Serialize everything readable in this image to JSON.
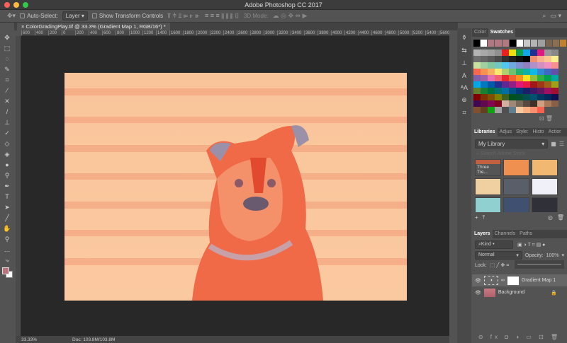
{
  "window": {
    "title": "Adobe Photoshop CC 2017",
    "traffic": [
      "#fc605c",
      "#fdbc40",
      "#34c84a"
    ]
  },
  "options": {
    "auto_select_label": "Auto-Select:",
    "auto_select_value": "Layer",
    "transform_label": "Show Transform Controls",
    "mode_3d_label": "3D Mode:"
  },
  "document": {
    "tab_title": "ColorGradingPlay.tif @ 33.3% (Gradient Map 1, RGB/16*) *",
    "ruler_ticks": [
      "600",
      "400",
      "200",
      "0",
      "200",
      "400",
      "600",
      "800",
      "1000",
      "1200",
      "1400",
      "1600",
      "1800",
      "2000",
      "2200",
      "2400",
      "2600",
      "2800",
      "3000",
      "3200",
      "3400",
      "3600",
      "3800",
      "4000",
      "4200",
      "4400",
      "4600",
      "4800",
      "5000",
      "5200",
      "5400",
      "5600",
      "5"
    ]
  },
  "status": {
    "zoom": "33.33%",
    "doc": "Doc: 103.8M/103.8M"
  },
  "swatches_panel": {
    "tabs": [
      "Color",
      "Swatches"
    ],
    "top_row": [
      "#000000",
      "#ffffff",
      "#b07880",
      "#b07880",
      "#b07880",
      "#000000",
      "#ffffff",
      "#c8c8c8",
      "#b4b4b4",
      "#a0a0a0",
      "#7a6650",
      "#8a7050",
      "#c08030"
    ],
    "grid": [
      "#b4b4b4",
      "#a8a8a8",
      "#a0a0a0",
      "#909090",
      "#e82020",
      "#f0e010",
      "#10a050",
      "#10a8e8",
      "#203090",
      "#e01880",
      "#989898",
      "#888888",
      "#707070",
      "#666666",
      "#5a5a5a",
      "#4a4a4a",
      "#303030",
      "#202020",
      "#101010",
      "#000000",
      "#f09070",
      "#f8b090",
      "#f8c890",
      "#f8f090",
      "#c8e0a0",
      "#a0d0a0",
      "#80c8a0",
      "#70c8c0",
      "#50c8f0",
      "#70a8e0",
      "#8090d0",
      "#9080c0",
      "#b090c8",
      "#d090c0",
      "#f090c0",
      "#f89090",
      "#f86850",
      "#f89050",
      "#f8b060",
      "#f8e870",
      "#b0d070",
      "#70c070",
      "#20b070",
      "#10b0a8",
      "#10b8e8",
      "#3088d0",
      "#4068c0",
      "#6050a8",
      "#8060a8",
      "#a060a8",
      "#e870b0",
      "#f06070",
      "#e82830",
      "#f06030",
      "#f89020",
      "#f8e020",
      "#90c040",
      "#30b040",
      "#00a050",
      "#00a8a0",
      "#00a8e8",
      "#0078c0",
      "#0058a8",
      "#203090",
      "#602890",
      "#902088",
      "#e01878",
      "#e81848",
      "#a01818",
      "#a03818",
      "#a06018",
      "#a0a018",
      "#608030",
      "#188030",
      "#007040",
      "#007070",
      "#0070a0",
      "#005088",
      "#003878",
      "#182068",
      "#401868",
      "#601860",
      "#a01060",
      "#a01030",
      "#800000",
      "#803000",
      "#805000",
      "#808000",
      "#406020",
      "#005020",
      "#005030",
      "#005050",
      "#005070",
      "#003860",
      "#002858",
      "#101050",
      "#400850",
      "#600850",
      "#800850",
      "#800020",
      "#d0b0a0",
      "#a08878",
      "#786858",
      "#584840",
      "#403028",
      "#d0a080",
      "#a87858",
      "#886048",
      "#805030",
      "#604020",
      "#10a010",
      "#a0a0a0",
      "#505050",
      "#608090",
      "#f8c8a0",
      "#f8b080",
      "#f89070",
      "#f86050"
    ]
  },
  "libraries_panel": {
    "tabs": [
      "Libraries",
      "Adjus",
      "Style:",
      "Histo",
      "Actior"
    ],
    "library": "My Library",
    "search_placeholder": "Search Adobe Stock",
    "first_label": "Three Tre...",
    "colors": [
      "#c06040",
      "#f09050",
      "#f0b870",
      "#f0d0a0",
      "#5a5e68",
      "#f0f0f8",
      "#90d0d0",
      "#405070",
      "#303038",
      "#202020",
      "#f05020",
      "#f09040"
    ]
  },
  "layers_panel": {
    "tabs": [
      "Layers",
      "Channels",
      "Paths"
    ],
    "filter": "Kind",
    "blend": "Normal",
    "opacity_label": "Opacity:",
    "opacity": "100%",
    "lock_label": "Lock:",
    "layers": [
      {
        "name": "Gradient Map 1",
        "selected": true
      },
      {
        "name": "Background",
        "locked": true
      }
    ]
  },
  "colors": {
    "foreground": "#b87580",
    "background": "#ffffff"
  }
}
